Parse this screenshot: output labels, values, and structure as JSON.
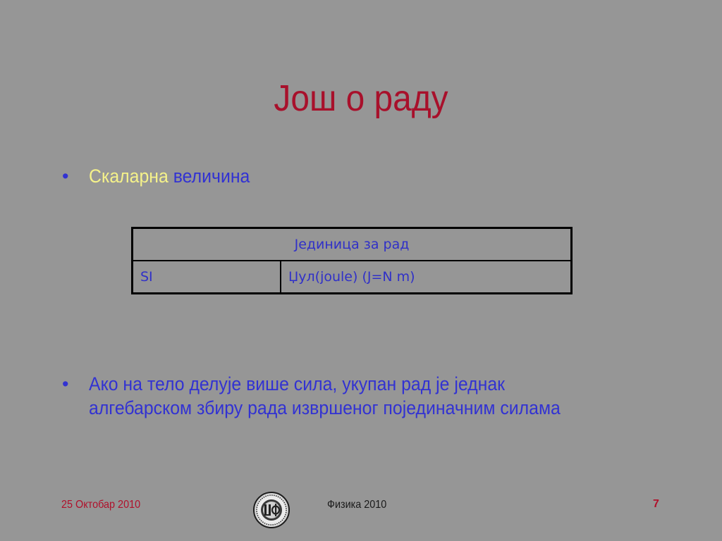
{
  "slide": {
    "title": "Још о раду",
    "bullet_mark": "•",
    "bullet1": {
      "word1": "Скаларна",
      "word2": "величина"
    },
    "table": {
      "header": "Јединица за рад",
      "row_label": "SI",
      "row_value": "Џул(joule) (J=N m)"
    },
    "bullet2": "Ако на тело делује више сила, укупан рад је једнак алгебарском збиру рада извршеног појединачним силама"
  },
  "footer": {
    "date": "25 Октобар 2010",
    "center": "Физика 2010",
    "page_number": "7"
  },
  "colors": {
    "background": "#969696",
    "title": "#a8102b",
    "blue_text": "#3232d2",
    "yellow_text": "#f5f28a",
    "footer_red": "#b0102b"
  },
  "icons": {
    "logo": "faculty-seal-logo"
  }
}
